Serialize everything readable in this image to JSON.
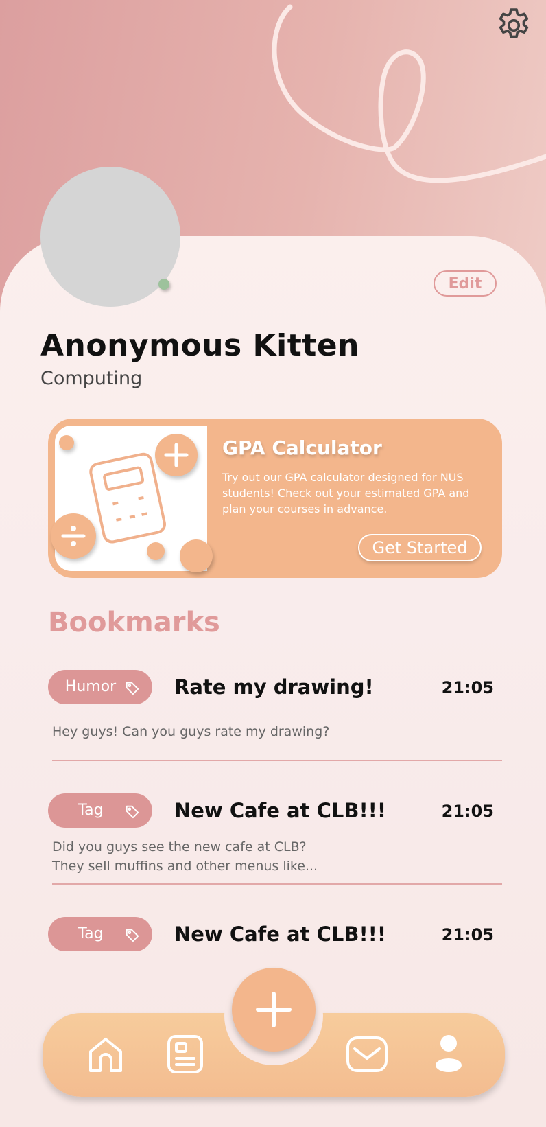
{
  "profile": {
    "name": "Anonymous Kitten",
    "department": "Computing",
    "edit_label": "Edit"
  },
  "gpa_card": {
    "title": "GPA Calculator",
    "description": "Try out our GPA calculator designed for NUS students! Check out your estimated GPA and plan your courses in advance.",
    "button_label": "Get Started"
  },
  "bookmarks": {
    "title": "Bookmarks",
    "posts": [
      {
        "tag": "Humor",
        "title": "Rate my drawing!",
        "time": "21:05",
        "body_line1": "Hey guys! Can you guys rate my drawing?",
        "body_line2": ""
      },
      {
        "tag": "Tag",
        "title": "New Cafe at CLB!!!",
        "time": "21:05",
        "body_line1": "Did you guys see the new cafe at CLB?",
        "body_line2": "They sell muffins and other menus like..."
      },
      {
        "tag": "Tag",
        "title": "New Cafe at CLB!!!",
        "time": "21:05",
        "body_line1": "",
        "body_line2": ""
      }
    ]
  },
  "nav": {
    "items": [
      "home-icon",
      "posts-icon",
      "add-icon",
      "mail-icon",
      "profile-icon"
    ]
  },
  "colors": {
    "accent_pink": "#dc9696",
    "accent_orange": "#f3b68c",
    "online_green": "#9dc29c"
  }
}
